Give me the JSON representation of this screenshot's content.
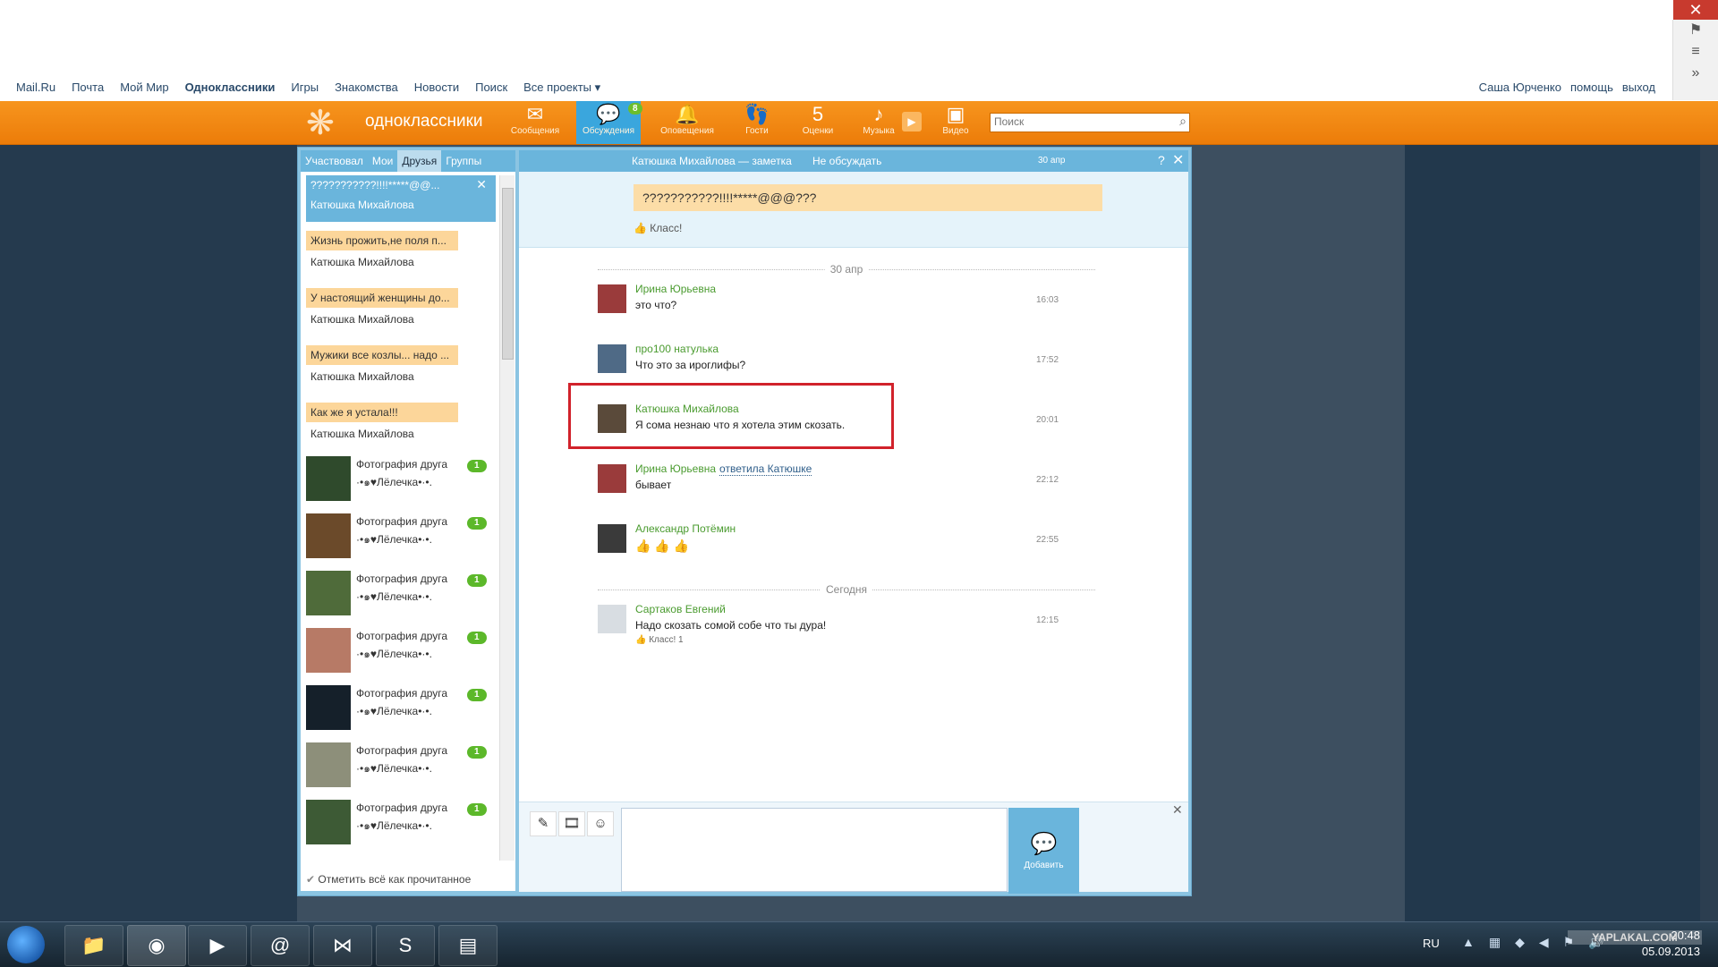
{
  "portal": {
    "links": [
      "Mail.Ru",
      "Почта",
      "Мой Мир",
      "Одноклассники",
      "Игры",
      "Знакомства",
      "Новости",
      "Поиск",
      "Все проекты ▾"
    ],
    "user": "Саша Юрченко",
    "help": "помощь",
    "logout": "выход"
  },
  "header": {
    "brand": "одноклассники",
    "nav": [
      {
        "label": "Сообщения",
        "icon": "✉"
      },
      {
        "label": "Обсуждения",
        "icon": "💬"
      },
      {
        "label": "Оповещения",
        "icon": "🔔"
      },
      {
        "label": "Гости",
        "icon": "👣"
      },
      {
        "label": "Оценки",
        "icon": "5"
      },
      {
        "label": "Музыка",
        "icon": "♪"
      },
      {
        "label": "Видео",
        "icon": "▣"
      }
    ],
    "discussions_badge": "8",
    "search_placeholder": "Поиск"
  },
  "left": {
    "tabs": [
      "Участвовал",
      "Мои",
      "Друзья",
      "Группы"
    ],
    "active_topic": {
      "title": "???????????!!!!*****@@...",
      "author": "Катюшка Михайлова"
    },
    "topics": [
      {
        "title": "Жизнь прожить,не поля п...",
        "author": "Катюшка Михайлова"
      },
      {
        "title": "У настоящий женщины до...",
        "author": "Катюшка Михайлова"
      },
      {
        "title": "Мужики все козлы... надо ...",
        "author": "Катюшка Михайлова"
      },
      {
        "title": "Как же я устала!!!",
        "author": "Катюшка Михайлова"
      }
    ],
    "photos": [
      {
        "title": "Фотография друга",
        "name": "·•๑♥Лёлечка•·•.",
        "badge": "1",
        "color": "#2f4a2c"
      },
      {
        "title": "Фотография друга",
        "name": "·•๑♥Лёлечка•·•.",
        "badge": "1",
        "color": "#6b4a2a"
      },
      {
        "title": "Фотография друга",
        "name": "·•๑♥Лёлечка•·•.",
        "badge": "1",
        "color": "#4f6b3a"
      },
      {
        "title": "Фотография друга",
        "name": "·•๑♥Лёлечка•·•.",
        "badge": "1",
        "color": "#b77a66"
      },
      {
        "title": "Фотография друга",
        "name": "·•๑♥Лёлечка•·•.",
        "badge": "1",
        "color": "#15202a"
      },
      {
        "title": "Фотография друга",
        "name": "·•๑♥Лёлечка•·•.",
        "badge": "1",
        "color": "#8d8f7a"
      },
      {
        "title": "Фотография друга",
        "name": "·•๑♥Лёлечка•·•.",
        "badge": "1",
        "color": "#3d5a35"
      }
    ],
    "mark_all_read": "Отметить всё как прочитанное"
  },
  "discussion": {
    "title": "Катюшка Михайлова — заметка",
    "unfollow": "Не обсуждать",
    "date": "30 апр",
    "note_text": "???????????!!!!*****@@@???",
    "note_like": "Класс!",
    "divider1": "30 апр",
    "divider2": "Сегодня",
    "messages": [
      {
        "name": "Ирина Юрьевна",
        "text": "это что?",
        "time": "16:03",
        "color": "#9a3b3b"
      },
      {
        "name": "про100 натулька",
        "text": "Что это за ироглифы?",
        "time": "17:52",
        "color": "#4f6a86"
      },
      {
        "name": "Катюшка Михайлова",
        "text": "Я сома незнаю что я хотела этим скозать.",
        "time": "20:01",
        "color": "#5a4a3a"
      },
      {
        "name": "Ирина Юрьевна",
        "reply": "ответила Катюшке",
        "text": "бывает",
        "time": "22:12",
        "color": "#9a3b3b"
      },
      {
        "name": "Александр Потёмин",
        "text": "",
        "time": "22:55",
        "color": "#3a3a3a"
      },
      {
        "name": "Сартаков Евгений",
        "text": "Надо скозать сомой собе что ты дура!",
        "time": "12:15",
        "like": "Класс! 1",
        "color": "#d8dde2"
      }
    ],
    "add_label": "Добавить"
  },
  "taskbar": {
    "lang": "RU",
    "time": "20:48",
    "date": "05.09.2013",
    "watermark": "YAPLAKAL.COM"
  }
}
